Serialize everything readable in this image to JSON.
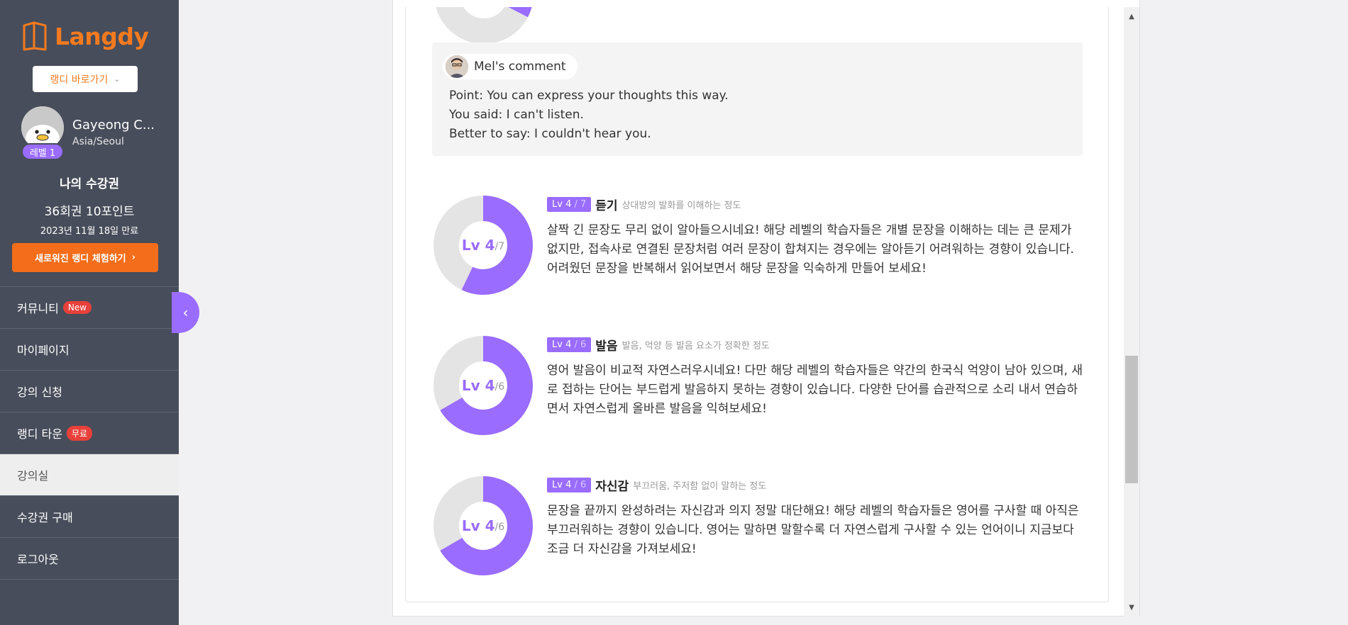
{
  "brand": {
    "name": "Langdy",
    "color": "#f47a1f"
  },
  "sidebar": {
    "goto_label": "랭디 바로가기",
    "profile": {
      "name": "Gayeong C...",
      "timezone": "Asia/Seoul",
      "level": "레벨 1"
    },
    "pass": {
      "title": "나의 수강권",
      "count": "36회권 10포인트",
      "expire": "2023년 11월 18일 만료"
    },
    "trial_label": "새로워진 랭디 체험하기",
    "menu": [
      {
        "label": "커뮤니티",
        "badge": "New"
      },
      {
        "label": "마이페이지"
      },
      {
        "label": "강의 신청"
      },
      {
        "label": "랭디 타운",
        "badge": "무료"
      },
      {
        "label": "강의실",
        "active": true
      },
      {
        "label": "수강권 구매"
      },
      {
        "label": "로그아웃"
      }
    ]
  },
  "comment": {
    "author": "Mel's comment",
    "lines": [
      "Point: You can express your thoughts this way.",
      "You said: I can't listen.",
      "Better to say: I couldn't hear you."
    ]
  },
  "scores": [
    {
      "lv": "Lv 4",
      "max": "/ 7",
      "donut_big": "Lv 4",
      "donut_small": "/7",
      "level": 4,
      "out_of": 7,
      "name": "듣기",
      "desc": "상대방의 발화를 이해하는 정도",
      "body": "살짝 긴 문장도 무리 없이 알아들으시네요! 해당 레벨의 학습자들은 개별 문장을 이해하는 데는 큰 문제가 없지만, 접속사로 연결된 문장처럼 여러 문장이 합쳐지는 경우에는 알아듣기 어려워하는 경향이 있습니다. 어려웠던 문장을 반복해서 읽어보면서 해당 문장을 익숙하게 만들어 보세요!"
    },
    {
      "lv": "Lv 4",
      "max": "/ 6",
      "donut_big": "Lv 4",
      "donut_small": "/6",
      "level": 4,
      "out_of": 6,
      "name": "발음",
      "desc": "발음, 억양 등 발음 요소가 정확한 정도",
      "body": "영어 발음이 비교적 자연스러우시네요! 다만 해당 레벨의 학습자들은 약간의 한국식 억양이 남아 있으며, 새로 접하는 단어는 부드럽게 발음하지 못하는 경향이 있습니다. 다양한 단어를 습관적으로 소리 내서 연습하면서 자연스럽게 올바른 발음을 익혀보세요!"
    },
    {
      "lv": "Lv 4",
      "max": "/ 6",
      "donut_big": "Lv 4",
      "donut_small": "/6",
      "level": 4,
      "out_of": 6,
      "name": "자신감",
      "desc": "부끄러움, 주저함 없이 말하는 정도",
      "body": "문장을 끝까지 완성하려는 자신감과 의지 정말 대단해요! 해당 레벨의 학습자들은 영어를 구사할 때 아직은 부끄러워하는 경향이 있습니다. 영어는 말하면 말할수록 더 자연스럽게 구사할 수 있는 언어이니 지금보다 조금 더 자신감을 가져보세요!"
    }
  ],
  "colors": {
    "accent": "#9a6cff",
    "donut_track": "#e4e4e4",
    "sidebar_bg": "#474d5a",
    "cta": "#f36d1a"
  }
}
